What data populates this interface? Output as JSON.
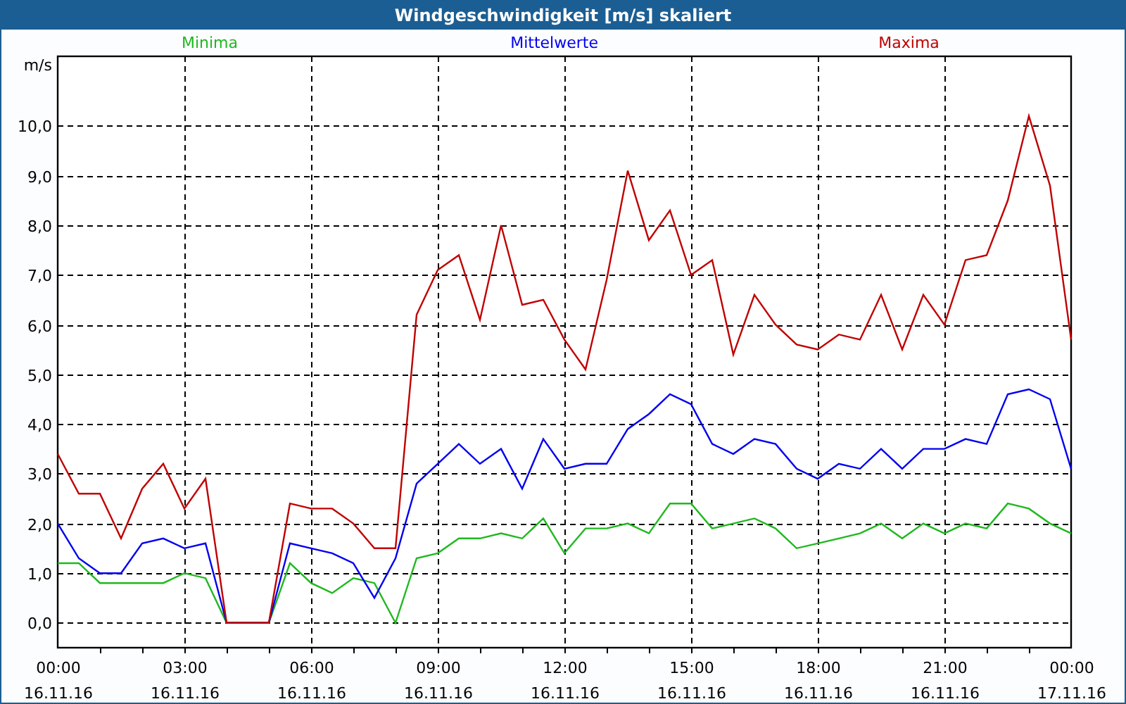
{
  "window": {
    "title": "Windgeschwindigkeit [m/s] skaliert"
  },
  "chart": {
    "chart_data": {
      "type": "line",
      "grid": true,
      "ylabel": "m/s",
      "ylim": [
        -0.5,
        11.4
      ],
      "categories": [
        "00:00 16.11.16",
        null,
        null,
        null,
        null,
        null,
        "03:00 16.11.16",
        null,
        null,
        null,
        null,
        null,
        "06:00 16.11.16",
        null,
        null,
        null,
        null,
        null,
        "09:00 16.11.16",
        null,
        null,
        null,
        null,
        null,
        "12:00 16.11.16",
        null,
        null,
        null,
        null,
        null,
        "15:00 16.11.16",
        null,
        null,
        null,
        null,
        null,
        "18:00 16.11.16",
        null,
        null,
        null,
        null,
        null,
        "21:00 16.11.16",
        null,
        null,
        null,
        null,
        null,
        "00:00 17.11.16"
      ],
      "yticks": [
        {
          "value": 0,
          "label": "0,0"
        },
        {
          "value": 1,
          "label": "1,0"
        },
        {
          "value": 2,
          "label": "2,0"
        },
        {
          "value": 3,
          "label": "3,0"
        },
        {
          "value": 4,
          "label": "4,0"
        },
        {
          "value": 5,
          "label": "5,0"
        },
        {
          "value": 6,
          "label": "6,0"
        },
        {
          "value": 7,
          "label": "7,0"
        },
        {
          "value": 8,
          "label": "8,0"
        },
        {
          "value": 9,
          "label": "9,0"
        },
        {
          "value": 10,
          "label": "10,0"
        }
      ],
      "series": [
        {
          "name": "Minima",
          "color": "#1fb81f",
          "values": [
            1.2,
            1.2,
            0.8,
            0.8,
            0.8,
            0.8,
            1.0,
            0.9,
            0,
            0,
            0,
            1.2,
            0.8,
            0.6,
            0.9,
            0.8,
            0,
            1.3,
            1.4,
            1.7,
            1.7,
            1.8,
            1.7,
            2.1,
            1.4,
            1.9,
            1.9,
            2.0,
            1.8,
            2.4,
            2.4,
            1.9,
            2.0,
            2.1,
            1.9,
            1.5,
            1.6,
            1.7,
            1.8,
            2.0,
            1.7,
            2.0,
            1.8,
            2.0,
            1.9,
            2.4,
            2.3,
            2.0,
            1.8
          ]
        },
        {
          "name": "Mittelwerte",
          "color": "#0000f0",
          "values": [
            2.0,
            1.3,
            1.0,
            1.0,
            1.6,
            1.7,
            1.5,
            1.6,
            0,
            0,
            0,
            1.6,
            1.5,
            1.4,
            1.2,
            0.5,
            1.3,
            2.8,
            3.2,
            3.6,
            3.2,
            3.5,
            2.7,
            3.7,
            3.1,
            3.2,
            3.2,
            3.9,
            4.2,
            4.6,
            4.4,
            3.6,
            3.4,
            3.7,
            3.6,
            3.1,
            2.9,
            3.2,
            3.1,
            3.5,
            3.1,
            3.5,
            3.5,
            3.7,
            3.6,
            4.6,
            4.7,
            4.5,
            3.1
          ]
        },
        {
          "name": "Maxima",
          "color": "#c00000",
          "values": [
            3.4,
            2.6,
            2.6,
            1.7,
            2.7,
            3.2,
            2.3,
            2.9,
            0,
            0,
            0,
            2.4,
            2.3,
            2.3,
            2.0,
            1.5,
            1.5,
            6.2,
            7.1,
            7.4,
            6.1,
            8.0,
            6.4,
            6.5,
            5.7,
            5.1,
            6.9,
            9.1,
            7.7,
            8.3,
            7.0,
            7.3,
            5.4,
            6.6,
            6.0,
            5.6,
            5.5,
            5.8,
            5.7,
            6.6,
            5.5,
            6.6,
            6.0,
            7.3,
            7.4,
            8.5,
            10.2,
            8.8,
            5.7
          ]
        }
      ]
    }
  }
}
